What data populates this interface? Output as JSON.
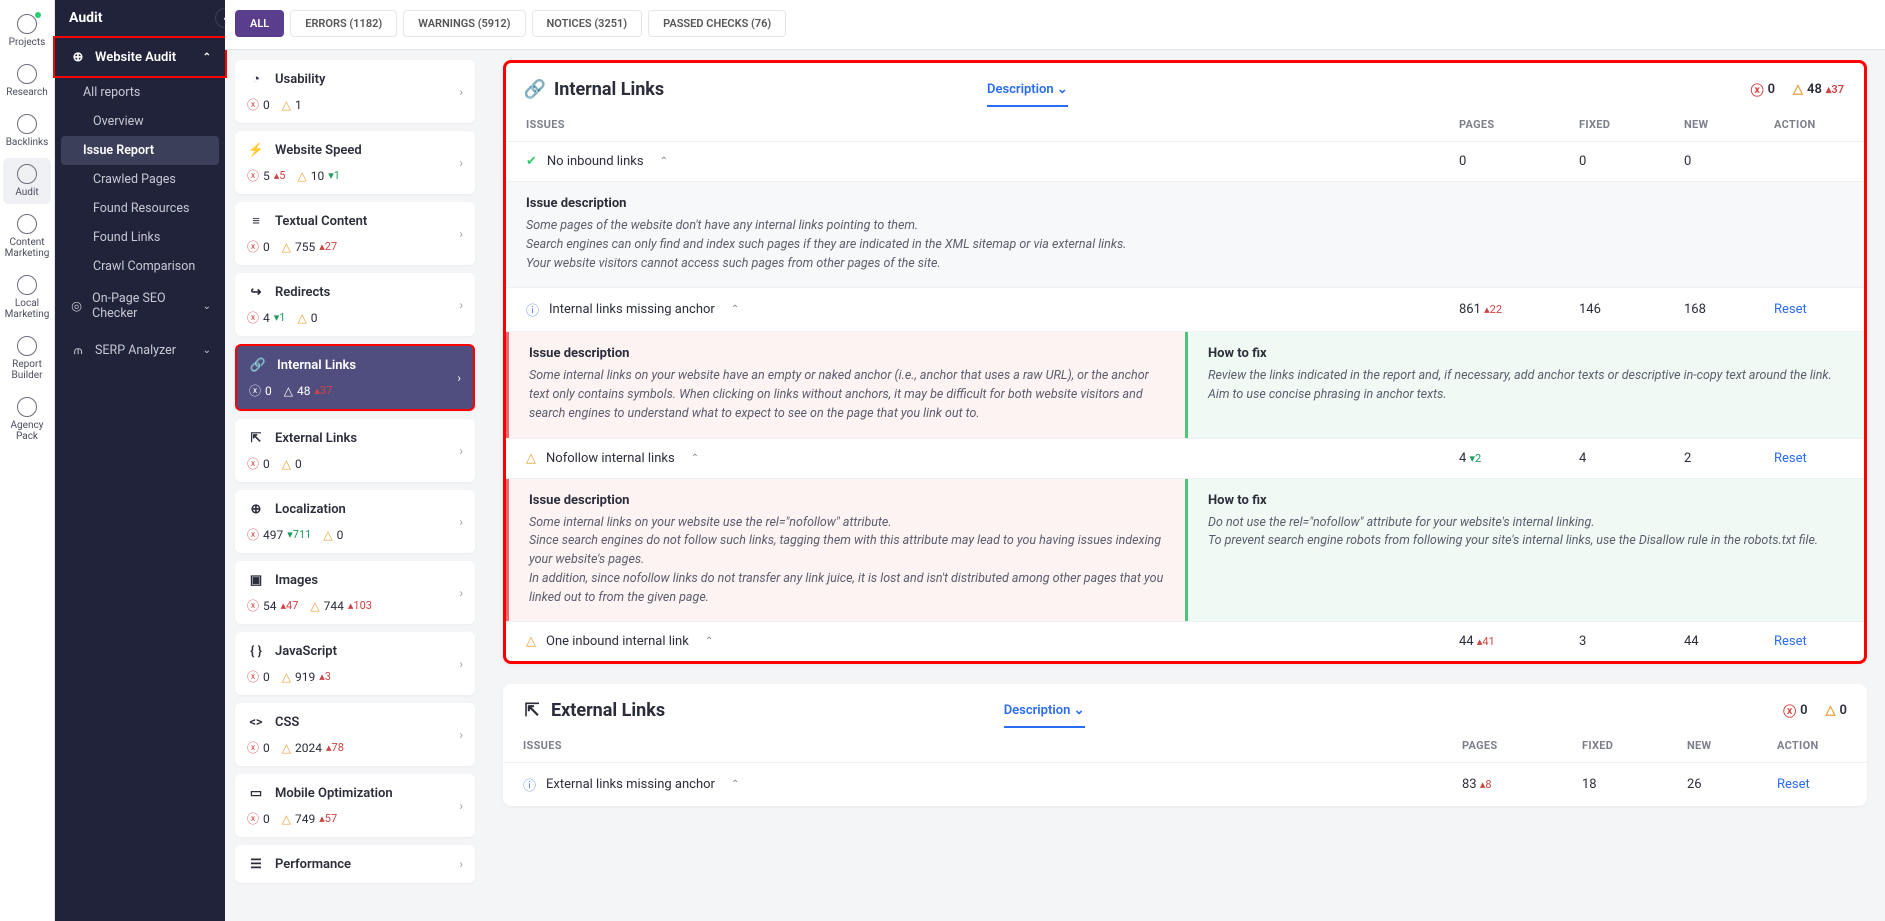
{
  "rail": [
    {
      "label": "Projects",
      "dot": true
    },
    {
      "label": "Research"
    },
    {
      "label": "Backlinks"
    },
    {
      "label": "Audit",
      "active": true
    },
    {
      "label": "Content Marketing"
    },
    {
      "label": "Local Marketing"
    },
    {
      "label": "Report Builder"
    },
    {
      "label": "Agency Pack"
    }
  ],
  "sidebar": {
    "title": "Audit",
    "section": "Website Audit",
    "items": [
      {
        "label": "All reports"
      },
      {
        "label": "Overview"
      },
      {
        "label": "Issue Report",
        "active": true
      },
      {
        "label": "Crawled Pages"
      },
      {
        "label": "Found Resources"
      },
      {
        "label": "Found Links"
      },
      {
        "label": "Crawl Comparison"
      }
    ],
    "extra": [
      {
        "label": "On-Page SEO Checker"
      },
      {
        "label": "SERP Analyzer"
      }
    ]
  },
  "tabs": [
    {
      "label": "ALL",
      "active": true
    },
    {
      "label": "ERRORS (1182)"
    },
    {
      "label": "WARNINGS (5912)"
    },
    {
      "label": "NOTICES (3251)"
    },
    {
      "label": "PASSED CHECKS (76)"
    }
  ],
  "categories": [
    {
      "name": "Usability",
      "err": "0",
      "warn": "1"
    },
    {
      "name": "Website Speed",
      "err": "5",
      "errD": "▴5",
      "warn": "10",
      "warnD": "▾1"
    },
    {
      "name": "Textual Content",
      "err": "0",
      "warn": "755",
      "warnD": "▴27"
    },
    {
      "name": "Redirects",
      "err": "4",
      "errD": "▾1",
      "warn": "0"
    },
    {
      "name": "Internal Links",
      "err": "0",
      "warn": "48",
      "warnD": "▴37",
      "active": true
    },
    {
      "name": "External Links",
      "err": "0",
      "warn": "0"
    },
    {
      "name": "Localization",
      "err": "497",
      "errD": "▾711",
      "warn": "0"
    },
    {
      "name": "Images",
      "err": "54",
      "errD": "▴47",
      "warn": "744",
      "warnD": "▴103"
    },
    {
      "name": "JavaScript",
      "err": "0",
      "warn": "919",
      "warnD": "▴3"
    },
    {
      "name": "CSS",
      "err": "0",
      "warn": "2024",
      "warnD": "▴78"
    },
    {
      "name": "Mobile Optimization",
      "err": "0",
      "warn": "749",
      "warnD": "▴57"
    },
    {
      "name": "Performance"
    }
  ],
  "main": {
    "internal": {
      "title": "Internal Links",
      "desc": "Description",
      "sumErr": "0",
      "sumWarn": "48",
      "sumWarnD": "▴37",
      "head": {
        "issues": "ISSUES",
        "pages": "PAGES",
        "fixed": "FIXED",
        "new": "NEW",
        "action": "ACTION"
      },
      "rows": [
        {
          "type": "ok",
          "name": "No inbound links",
          "pages": "0",
          "fixed": "0",
          "new": "0",
          "expanded": "full",
          "descH": "Issue description",
          "descB": "Some pages of the website don't have any internal links pointing to them.\nSearch engines can only find and index such pages if they are indicated in the XML sitemap or via external links.\nYour website visitors cannot access such pages from other pages of the site."
        },
        {
          "type": "info",
          "name": "Internal links missing anchor",
          "pages": "861",
          "pagesD": "▴22",
          "fixed": "146",
          "new": "168",
          "reset": "Reset",
          "expanded": "split",
          "descH": "Issue description",
          "descB": "Some internal links on your website have an empty or naked anchor (i.e., anchor that uses a raw URL), or the anchor text only contains symbols. When clicking on links without anchors, it may be difficult for both website visitors and search engines to understand what to expect to see on the page that you link out to.",
          "fixH": "How to fix",
          "fixB": "Review the links indicated in the report and, if necessary, add anchor texts or descriptive in-copy text around the link. Aim to use concise phrasing in anchor texts."
        },
        {
          "type": "warn",
          "name": "Nofollow internal links",
          "pages": "4",
          "pagesD": "▾2",
          "fixed": "4",
          "new": "2",
          "reset": "Reset",
          "expanded": "split",
          "descH": "Issue description",
          "descB": "Some internal links on your website use the rel=\"nofollow\" attribute.\nSince search engines do not follow such links, tagging them with this attribute may lead to you having issues indexing your website's pages.\nIn addition, since nofollow links do not transfer any link juice, it is lost and isn't distributed among other pages that you linked out to from the given page.",
          "fixH": "How to fix",
          "fixB": "Do not use the rel=\"nofollow\" attribute for your website's internal linking.\nTo prevent search engine robots from following your site's internal links, use the Disallow rule in the robots.txt file."
        },
        {
          "type": "warn",
          "name": "One inbound internal link",
          "pages": "44",
          "pagesD": "▴41",
          "fixed": "3",
          "new": "44",
          "reset": "Reset"
        }
      ]
    },
    "external": {
      "title": "External Links",
      "desc": "Description",
      "sumErr": "0",
      "sumWarn": "0",
      "head": {
        "issues": "ISSUES",
        "pages": "PAGES",
        "fixed": "FIXED",
        "new": "NEW",
        "action": "ACTION"
      },
      "rows": [
        {
          "type": "info",
          "name": "External links missing anchor",
          "pages": "83",
          "pagesD": "▴8",
          "fixed": "18",
          "new": "26",
          "reset": "Reset"
        }
      ]
    }
  }
}
